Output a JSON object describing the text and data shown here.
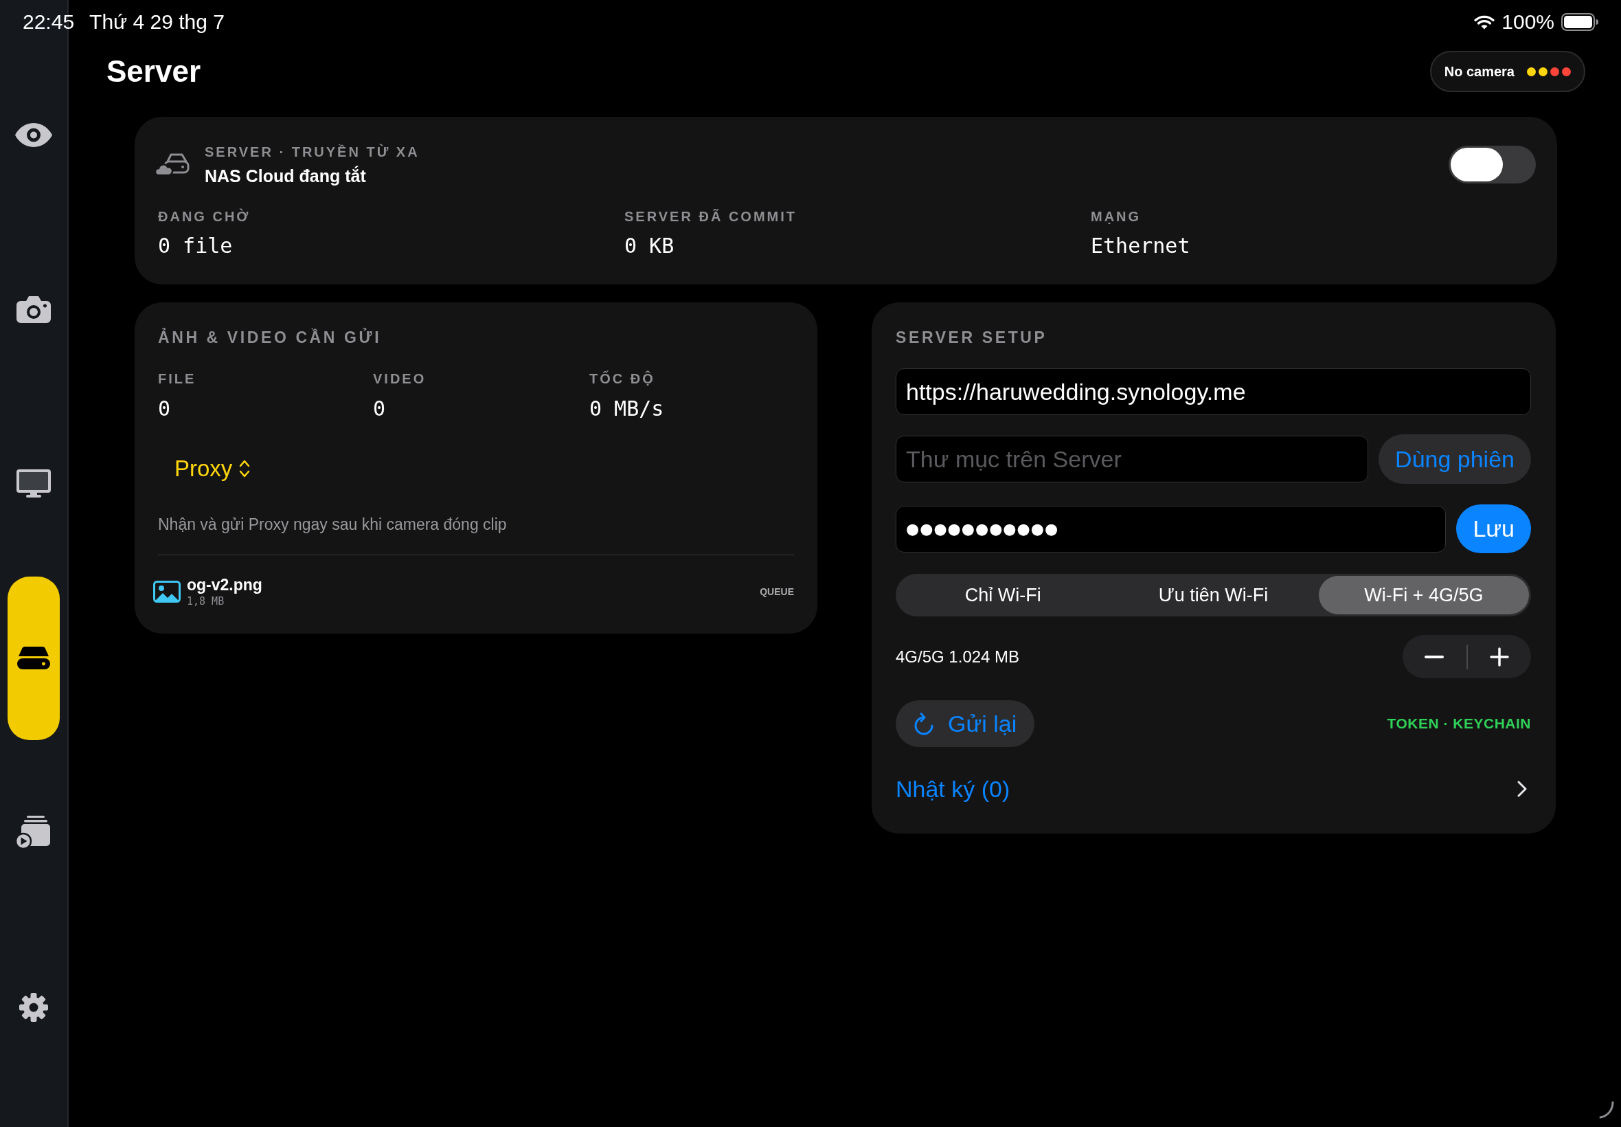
{
  "status_bar": {
    "time": "22:45",
    "date": "Thứ 4 29 thg 7",
    "battery": "100%"
  },
  "sidebar": {
    "items": [
      {
        "selected": false
      },
      {
        "selected": false
      },
      {
        "selected": false
      },
      {
        "selected": true
      },
      {
        "selected": false
      },
      {
        "selected": false
      }
    ]
  },
  "header": {
    "title": "Server",
    "camera_status": {
      "label": "No camera",
      "dots": [
        {
          "color": "#ffd60a"
        },
        {
          "color": "#ffd60a"
        },
        {
          "color": "#ff453a"
        },
        {
          "color": "#ff453a"
        }
      ]
    }
  },
  "server_card": {
    "eyebrow": "SERVER · TRUYỀN TỪ XA",
    "name": "NAS Cloud đang tắt",
    "toggle": {
      "on": false
    },
    "stats": [
      {
        "label": "ĐANG CHỜ",
        "value": "0 file"
      },
      {
        "label": "SERVER ĐÃ COMMIT",
        "value": "0 KB"
      },
      {
        "label": "MẠNG",
        "value": "Ethernet"
      }
    ]
  },
  "upload_card": {
    "title": "ẢNH & VIDEO CẦN GỬI",
    "stats": [
      {
        "label": "FILE",
        "value": "0"
      },
      {
        "label": "VIDEO",
        "value": "0"
      },
      {
        "label": "TỐC ĐỘ",
        "value": "0 MB/s"
      }
    ],
    "mode_picker": {
      "value": "Proxy"
    },
    "description": "Nhận và gửi Proxy ngay sau khi camera đóng clip",
    "files": [
      {
        "name": "og-v2.png",
        "size": "1,8 MB",
        "status": "QUEUE"
      }
    ]
  },
  "setup_card": {
    "title": "SERVER SETUP",
    "url_field": {
      "value": "https://haruwedding.synology.me"
    },
    "folder_field": {
      "placeholder": "Thư mục trên Server"
    },
    "session_button": "Dùng phiên",
    "password_field": {
      "value": "●●●●●●●●●●●"
    },
    "save_button": "Lưu",
    "network_modes": [
      {
        "label": "Chỉ Wi-Fi",
        "selected": false
      },
      {
        "label": "Ưu tiên Wi-Fi",
        "selected": false
      },
      {
        "label": "Wi-Fi + 4G/5G",
        "selected": true
      }
    ],
    "data_limit": "4G/5G 1.024 MB",
    "resend_button": "Gửi lại",
    "token_status": "TOKEN · KEYCHAIN",
    "log_link": "Nhật ký (0)"
  }
}
